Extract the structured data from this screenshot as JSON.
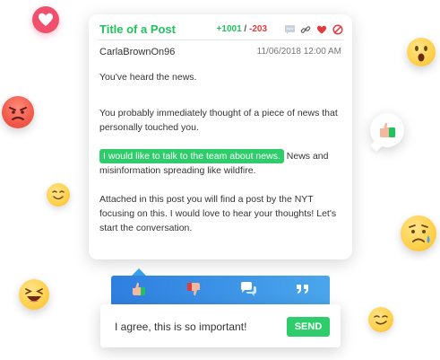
{
  "post": {
    "title": "Title of a Post",
    "upvotes": "+1001",
    "separator": " / ",
    "downvotes": "-203",
    "author": "CarlaBrownOn96",
    "date": "11/06/2018 12:00 AM",
    "paragraph1": "You've heard the news.",
    "paragraph2": "You probably immediately thought of a piece of news that personally touched you.",
    "highlight": "I would like to talk to the team about news.",
    "paragraph3_rest": " News and misinformation spreading like wildfire.",
    "paragraph4": "Attached in this post you will find a post by the NYT focusing on this. I would love to hear your thoughts! Let's start the conversation."
  },
  "header_icons": [
    "comment-icon",
    "link-icon",
    "heart-icon",
    "block-icon"
  ],
  "reaction_bar": {
    "buttons": [
      "thumbs-up-icon",
      "thumbs-down-icon",
      "chat-icon",
      "quote-icon"
    ]
  },
  "comment": {
    "value": "I agree, this is so important!",
    "send_label": "SEND"
  },
  "colors": {
    "accent_green": "#21c25e",
    "downvote_red": "#e23b3b",
    "bar_blue": "#3a93e6",
    "heart_pink": "#f0506e"
  }
}
